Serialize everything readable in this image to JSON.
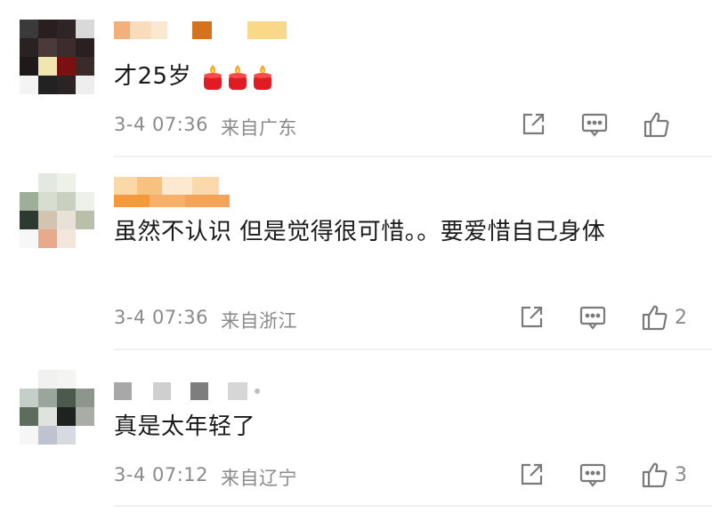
{
  "colors": {
    "text": "#1a1a1a",
    "meta": "#8a8a8a",
    "icon": "#7a7a7a",
    "divider": "#f0f0f0"
  },
  "comments": [
    {
      "content": "才25岁",
      "emoji": [
        "candle-emoji",
        "candle-emoji",
        "candle-emoji"
      ],
      "date": "3-4 07:36",
      "location": "来自广东",
      "likes": ""
    },
    {
      "content": "虽然不认识  但是觉得很可惜。。要爱惜自己身体",
      "date": "3-4 07:36",
      "location": "来自浙江",
      "likes": "2"
    },
    {
      "content": "真是太年轻了",
      "date": "3-4 07:12",
      "location": "来自辽宁",
      "likes": "3"
    }
  ],
  "icons": {
    "share": "share-icon",
    "comment": "comment-icon",
    "like": "thumbs-up-icon"
  }
}
